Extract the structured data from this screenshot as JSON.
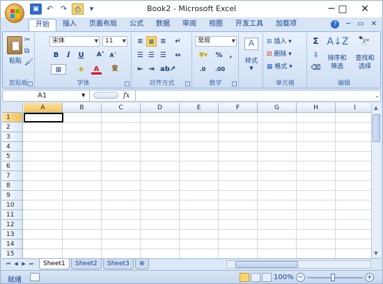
{
  "title": "Book2 - Microsoft Excel",
  "qat": {
    "save": "💾",
    "undo": "↶",
    "redo": "↷",
    "custom": "▾"
  },
  "window_controls": {
    "minimize": "─",
    "maximize": "□",
    "close": "✕"
  },
  "tabs": [
    {
      "label": "开始",
      "active": true
    },
    {
      "label": "插入"
    },
    {
      "label": "页面布局"
    },
    {
      "label": "公式"
    },
    {
      "label": "数据"
    },
    {
      "label": "审阅"
    },
    {
      "label": "视图"
    },
    {
      "label": "开发工具"
    },
    {
      "label": "加载项"
    }
  ],
  "tab_right": {
    "help": "?",
    "min": "─",
    "restore": "▭",
    "close": "✕"
  },
  "ribbon": {
    "clipboard": {
      "label": "剪贴板",
      "paste": "粘贴"
    },
    "font": {
      "label": "字体",
      "name": "宋体",
      "size": "11",
      "bold": "B",
      "italic": "I",
      "underline": "U",
      "grow": "A˄",
      "shrink": "A˅",
      "wen": "变"
    },
    "alignment": {
      "label": "对齐方式"
    },
    "number": {
      "label": "数字",
      "format": "常规",
      "percent": "%",
      "comma": ",",
      "inc": ".0",
      "dec": ".00"
    },
    "styles": {
      "label": "样式",
      "styles": "样式"
    },
    "cells": {
      "label": "单元格",
      "insert": "插入",
      "delete": "删除",
      "format": "格式"
    },
    "editing": {
      "label": "编辑",
      "sigma": "Σ",
      "sort": "排序和\n筛选",
      "find": "查找和\n选择"
    }
  },
  "formula_bar": {
    "name_box": "A1",
    "fx": "fx",
    "value": ""
  },
  "columns": [
    "A",
    "B",
    "C",
    "D",
    "E",
    "F",
    "G",
    "H",
    "I"
  ],
  "rows": [
    "1",
    "2",
    "3",
    "4",
    "5",
    "6",
    "7",
    "8",
    "9",
    "10",
    "11",
    "12",
    "13",
    "14",
    "15"
  ],
  "active_cell": "A1",
  "sheets": [
    {
      "label": "Sheet1",
      "active": true
    },
    {
      "label": "Sheet2"
    },
    {
      "label": "Sheet3"
    }
  ],
  "status": {
    "ready": "就绪",
    "zoom": "100%",
    "zoom_minus": "−",
    "zoom_plus": "+"
  },
  "colors": {
    "accent": "#15428b",
    "ribbon": "#dbe7f7",
    "selected": "#f9d56d"
  }
}
